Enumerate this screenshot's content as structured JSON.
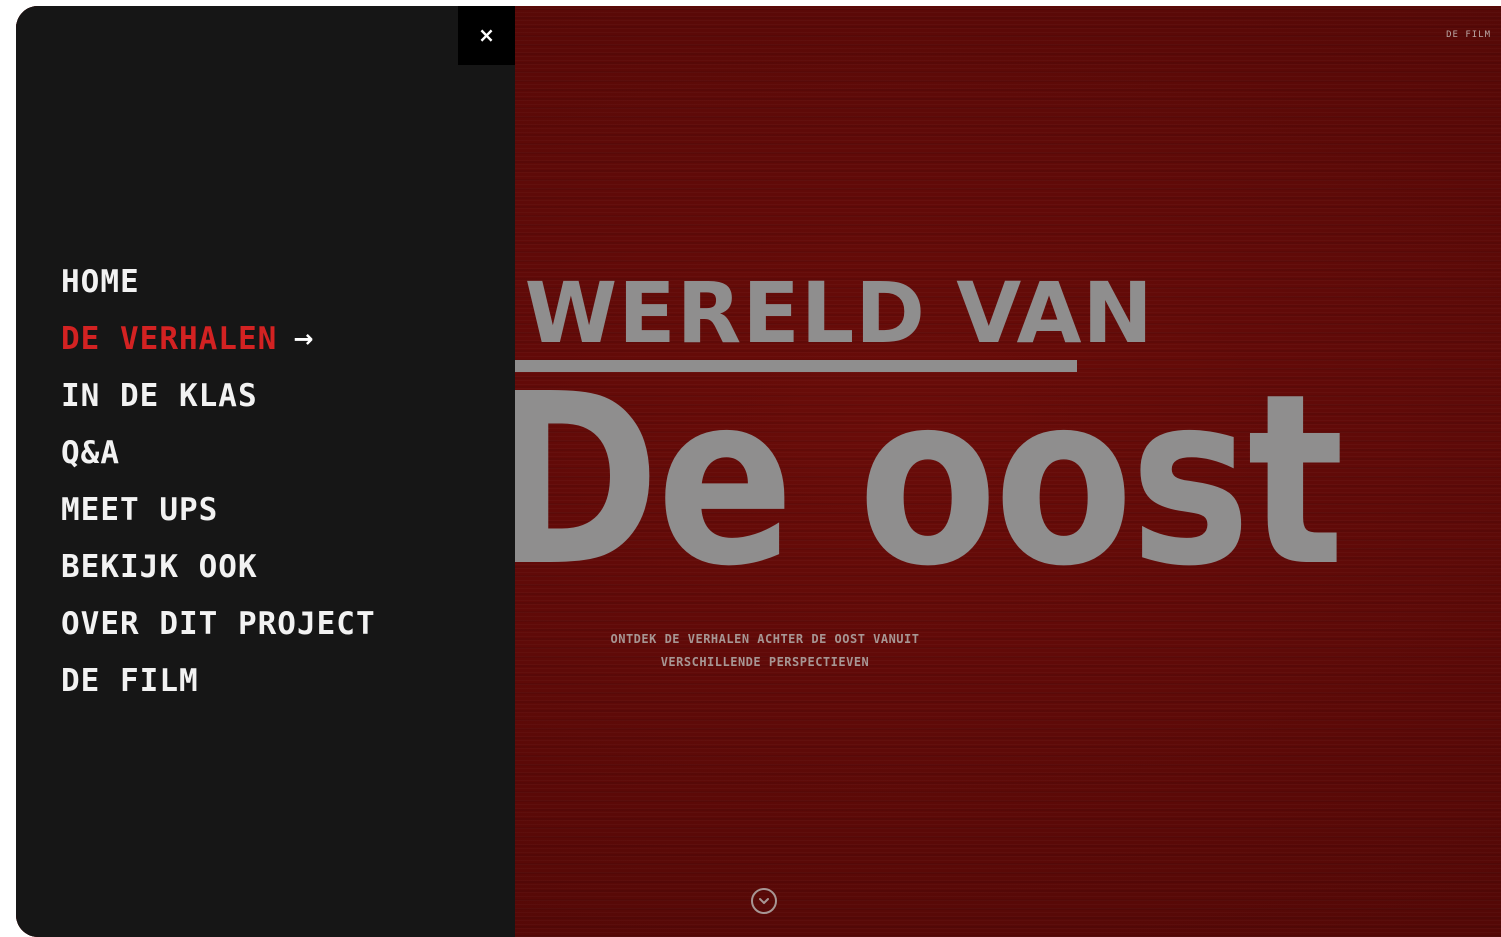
{
  "header": {
    "top_link": "DE FILM",
    "close_icon": "×"
  },
  "hero": {
    "title_line1": "E WERELD VAN",
    "title_line2": "De oost",
    "subtitle_line1": "ONTDEK DE VERHALEN ACHTER DE OOST VANUIT",
    "subtitle_line2": "VERSCHILLENDE PERSPECTIEVEN",
    "scroll_icon": "chevron-down-circle-icon"
  },
  "nav": {
    "items": [
      {
        "label": "HOME"
      },
      {
        "label": "DE VERHALEN",
        "active": true,
        "arrow": "→"
      },
      {
        "label": "IN DE KLAS"
      },
      {
        "label": "Q&A"
      },
      {
        "label": "MEET UPS"
      },
      {
        "label": "BEKIJK OOK"
      },
      {
        "label": "OVER DIT PROJECT"
      },
      {
        "label": "DE FILM"
      }
    ]
  },
  "colors": {
    "panel_bg": "#161616",
    "hero_bg": "#5e0a08",
    "title_gray": "#8f8e8e",
    "active_red": "#d32222",
    "nav_text": "#f2f2f2"
  }
}
